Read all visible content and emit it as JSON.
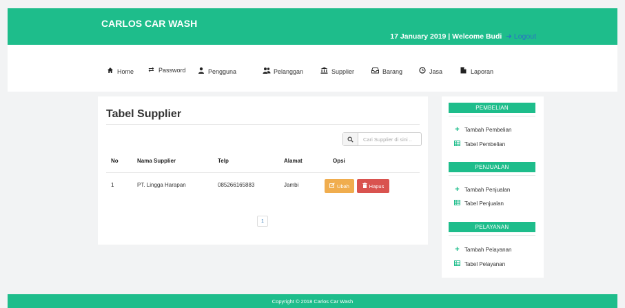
{
  "header": {
    "brand": "CARLOS CAR WASH",
    "welcome": "17 January 2019 | Welcome Budi",
    "logout_label": "Logout",
    "accent": "#1ebd8b"
  },
  "nav": {
    "items": [
      {
        "label": "Home",
        "icon": "home-icon"
      },
      {
        "label": "Password",
        "icon": "exchange-icon"
      },
      {
        "label": "Pengguna",
        "icon": "user-icon"
      },
      {
        "label": "Pelanggan",
        "icon": "users-icon"
      },
      {
        "label": "Supplier",
        "icon": "bank-icon"
      },
      {
        "label": "Barang",
        "icon": "inbox-icon"
      },
      {
        "label": "Jasa",
        "icon": "clock-icon"
      },
      {
        "label": "Laporan",
        "icon": "file-icon"
      }
    ]
  },
  "main": {
    "title": "Tabel Supplier",
    "search_placeholder": "Cari Supplier di sini ..",
    "columns": [
      "No",
      "Nama Supplier",
      "Telp",
      "Alamat",
      "Opsi"
    ],
    "rows": [
      {
        "no": "1",
        "nama": "PT. Lingga Harapan",
        "telp": "085266165883",
        "alamat": "Jambi"
      }
    ],
    "edit_label": "Ubah",
    "delete_label": "Hapus",
    "page": "1"
  },
  "sidebar": {
    "sections": [
      {
        "heading": "PEMBELIAN",
        "links": [
          "Tambah Pembelian",
          "Tabel Pembelian"
        ]
      },
      {
        "heading": "PENJUALAN",
        "links": [
          "Tambah Penjualan",
          "Tabel Penjualan"
        ]
      },
      {
        "heading": "PELAYANAN",
        "links": [
          "Tambah Pelayanan",
          "Tabel Pelayanan"
        ]
      }
    ]
  },
  "footer": {
    "text": "Copyright © 2018 Carlos Car Wash"
  }
}
